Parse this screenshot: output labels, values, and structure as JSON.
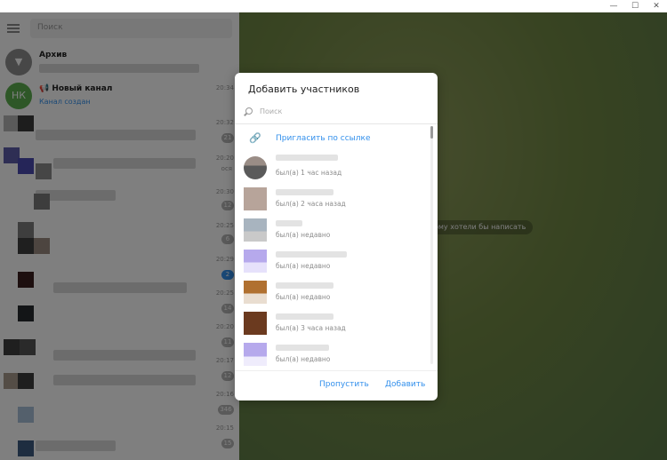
{
  "window": {
    "minimize": "—",
    "maximize": "☐",
    "close": "✕"
  },
  "sidebar": {
    "search_placeholder": "Поиск",
    "archive_label": "Архив",
    "new_channel": {
      "avatar_initials": "НК",
      "title": "📢 Новый канал",
      "subtitle": "Канал создан",
      "time": "20:34"
    },
    "times": [
      "20:32",
      "20:20",
      "20:30",
      "20:25",
      "20:29",
      "20:25",
      "20:20",
      "20:17",
      "20:16",
      "20:15"
    ],
    "badges": [
      "21",
      "5",
      "12",
      "6",
      "2",
      "14",
      "11",
      "12",
      "346",
      "15"
    ],
    "preview_fragment": "ося"
  },
  "chat": {
    "hint": "ому хотели бы написать"
  },
  "dialog": {
    "title": "Добавить участников",
    "search_placeholder": "Поиск",
    "invite_label": "Пригласить по ссылке",
    "members": [
      {
        "status": "был(а) 1 час назад"
      },
      {
        "status": "был(а) 2 часа назад"
      },
      {
        "status": "был(а) недавно"
      },
      {
        "status": "был(а) недавно"
      },
      {
        "status": "был(а) недавно"
      },
      {
        "status": "был(а) 3 часа назад"
      },
      {
        "status": "был(а) недавно"
      }
    ],
    "skip_label": "Пропустить",
    "add_label": "Добавить"
  },
  "colors": {
    "accent": "#3390ec",
    "new_channel_avatar": "#5caf4f",
    "archive_avatar": "#8f8f8f"
  }
}
